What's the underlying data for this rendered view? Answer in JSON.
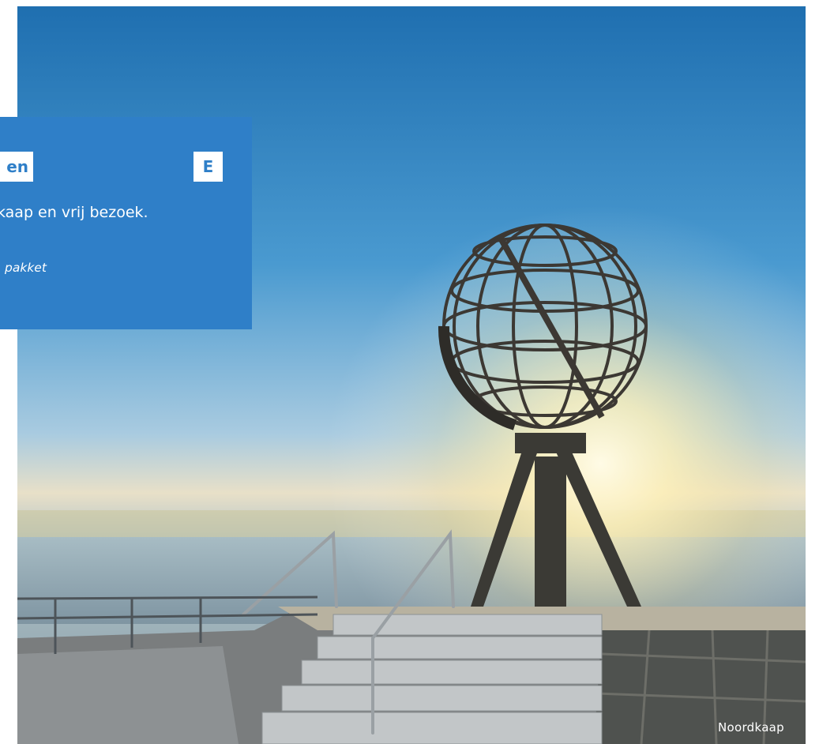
{
  "card": {
    "tag_left": "en",
    "tag_right": "E",
    "text": "kaap en vrij bezoek.",
    "subtext": "pakket"
  },
  "photo": {
    "caption": "Noordkaap"
  },
  "colors": {
    "card_blue": "#2f7fc8",
    "tag_bg": "#ffffff"
  }
}
